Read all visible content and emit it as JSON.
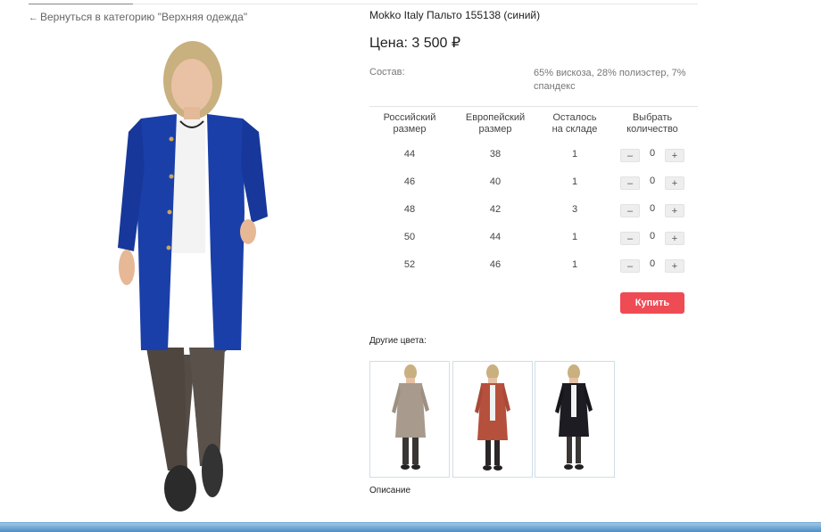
{
  "nav": {
    "back_label": "Вернуться в категорию \"Верхняя одежда\""
  },
  "product": {
    "title": "Mokko Italy Пальто 155138 (синий)",
    "price": "Цена: 3 500 ₽",
    "composition_label": "Состав:",
    "composition_value": "65% вискоза, 28% полиэстер, 7% спандекс"
  },
  "size_table": {
    "headers": [
      [
        "Российский",
        "размер"
      ],
      [
        "Европейский",
        "размер"
      ],
      [
        "Осталось",
        "на складе"
      ],
      [
        "Выбрать",
        "количество"
      ]
    ],
    "rows": [
      {
        "ru": "44",
        "eu": "38",
        "stock": "1",
        "qty": "0"
      },
      {
        "ru": "46",
        "eu": "40",
        "stock": "1",
        "qty": "0"
      },
      {
        "ru": "48",
        "eu": "42",
        "stock": "3",
        "qty": "0"
      },
      {
        "ru": "50",
        "eu": "44",
        "stock": "1",
        "qty": "0"
      },
      {
        "ru": "52",
        "eu": "46",
        "stock": "1",
        "qty": "0"
      }
    ],
    "minus_label": "–",
    "plus_label": "+"
  },
  "buy_label": "Купить",
  "other_colors": {
    "label": "Другие цвета:",
    "swatches": [
      "#a89a8c",
      "#b5503d",
      "#1c1c22"
    ]
  },
  "description_label": "Описание",
  "main_color": "#1a3fa8"
}
